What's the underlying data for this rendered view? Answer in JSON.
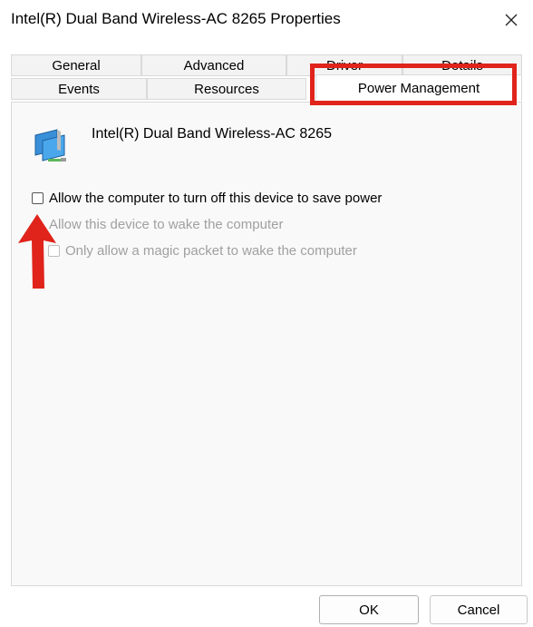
{
  "window": {
    "title": "Intel(R) Dual Band Wireless-AC 8265 Properties"
  },
  "tabs": {
    "row1": [
      {
        "label": "General"
      },
      {
        "label": "Advanced"
      },
      {
        "label": "Driver"
      },
      {
        "label": "Details"
      }
    ],
    "row2": [
      {
        "label": "Events"
      },
      {
        "label": "Resources"
      },
      {
        "label": "Power Management"
      }
    ],
    "active": "Power Management"
  },
  "panel": {
    "device_name": "Intel(R) Dual Band Wireless-AC 8265",
    "device_icon": "network-adapter-icon",
    "options": [
      {
        "label": "Allow the computer to turn off this device to save power",
        "checked": false,
        "enabled": true
      },
      {
        "label": "Allow this device to wake the computer",
        "checked": false,
        "enabled": false
      },
      {
        "label": "Only allow a magic packet to wake the computer",
        "checked": false,
        "enabled": false
      }
    ]
  },
  "buttons": {
    "ok_label": "OK",
    "cancel_label": "Cancel"
  },
  "annotations": {
    "highlight_color": "#e0241b",
    "arrow_color": "#e0241b"
  }
}
